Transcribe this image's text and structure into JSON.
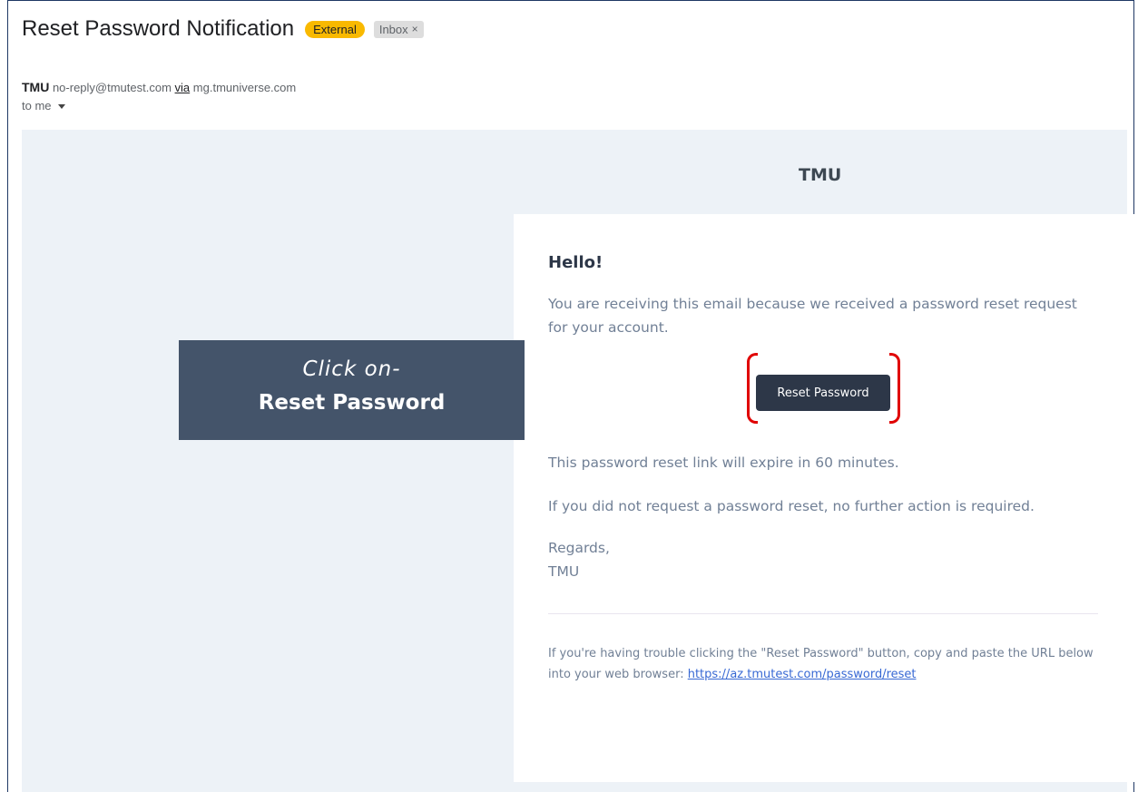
{
  "email": {
    "subject": "Reset Password Notification",
    "labels": {
      "external": "External",
      "inbox": "Inbox",
      "remove": "×"
    },
    "sender": {
      "name": "TMU",
      "address": "no-reply@tmutest.com",
      "via_label": "via",
      "via_domain": "mg.tmuniverse.com"
    },
    "recipient": "to me"
  },
  "body": {
    "brand": "TMU",
    "greeting": "Hello!",
    "intro": "You are receiving this email because we received a password reset request for your account.",
    "button_label": "Reset Password",
    "expiry": "This password reset link will expire in 60 minutes.",
    "no_action": "If you did not request a password reset, no further action is required.",
    "regards": "Regards,",
    "signature": "TMU",
    "trouble_text": "If you're having trouble clicking the \"Reset Password\" button, copy and paste the URL below into your web browser:",
    "trouble_link": "https://az.tmutest.com/password/reset"
  },
  "annotation": {
    "line1": "Click on-",
    "line2": "Reset Password"
  },
  "colors": {
    "button_bg": "#2d3748",
    "external_badge": "#f9b900",
    "callout_bg": "#44546a",
    "highlight": "#e00000",
    "email_bg": "#edf2f7"
  }
}
